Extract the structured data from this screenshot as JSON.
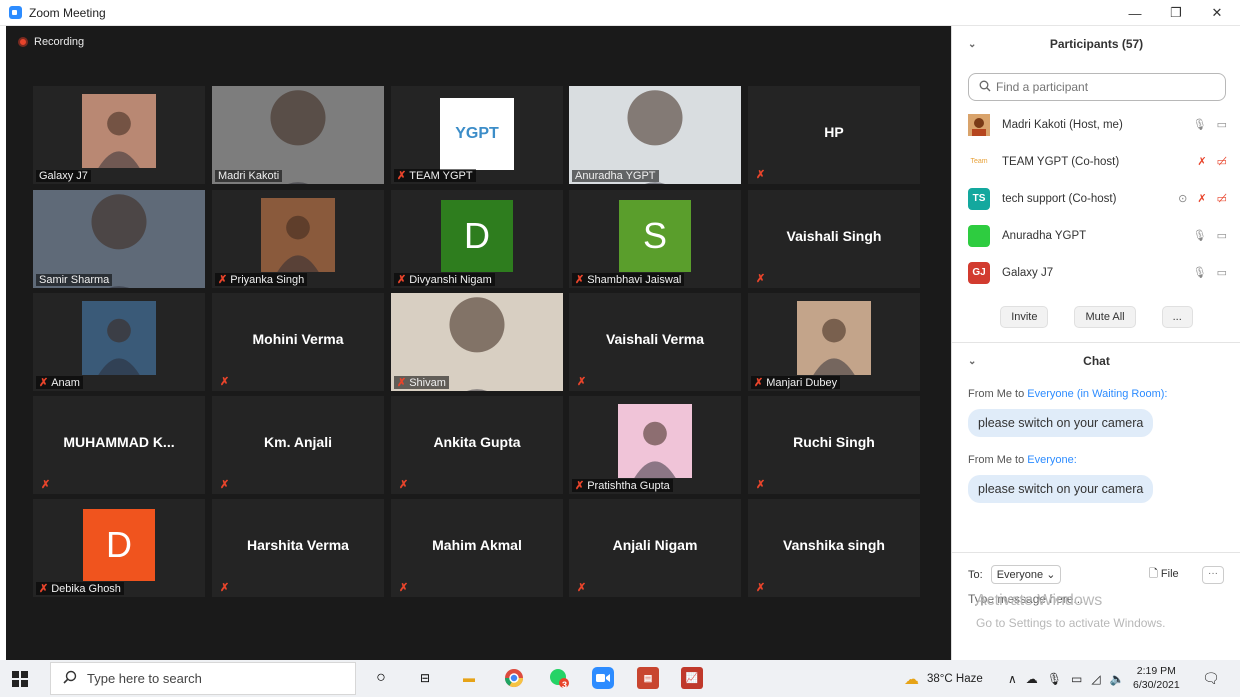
{
  "window": {
    "title": "Zoom Meeting",
    "minimize": "—",
    "maximize": "❐",
    "close": "✕"
  },
  "meeting": {
    "recording_label": "Recording",
    "tiles": [
      {
        "name": "Galaxy J7",
        "kind": "photo",
        "mic_muted": false
      },
      {
        "name": "Madri Kakoti",
        "kind": "photo-full",
        "mic_muted": false
      },
      {
        "name": "TEAM YGPT",
        "kind": "logo",
        "logo_text": "YGPT",
        "mic_muted": true
      },
      {
        "name": "Anuradha YGPT",
        "kind": "photo-full",
        "mic_muted": false,
        "active": true
      },
      {
        "name": "HP",
        "kind": "name-only",
        "mic_muted": true
      },
      {
        "name": "Samir Sharma",
        "kind": "photo-full",
        "mic_muted": false
      },
      {
        "name": "Priyanka Singh",
        "kind": "photo",
        "mic_muted": true
      },
      {
        "name": "Divyanshi Nigam",
        "kind": "letter",
        "letter": "D",
        "color": "#2e7d1e",
        "mic_muted": true
      },
      {
        "name": "Shambhavi Jaiswal",
        "kind": "letter",
        "letter": "S",
        "color": "#5a9e2c",
        "mic_muted": true
      },
      {
        "name": "Vaishali Singh",
        "kind": "name-only",
        "mic_muted": true
      },
      {
        "name": "Anam",
        "kind": "photo",
        "mic_muted": true
      },
      {
        "name": "Mohini Verma",
        "kind": "name-only",
        "mic_muted": true
      },
      {
        "name": "Shivam",
        "kind": "photo-full",
        "mic_muted": true
      },
      {
        "name": "Vaishali Verma",
        "kind": "name-only",
        "mic_muted": true
      },
      {
        "name": "Manjari Dubey",
        "kind": "photo",
        "mic_muted": true
      },
      {
        "name": "MUHAMMAD  K...",
        "kind": "name-only",
        "mic_muted": true
      },
      {
        "name": "Km. Anjali",
        "kind": "name-only",
        "mic_muted": true
      },
      {
        "name": "Ankita Gupta",
        "kind": "name-only",
        "mic_muted": true
      },
      {
        "name": "Pratishtha Gupta",
        "kind": "photo",
        "mic_muted": true
      },
      {
        "name": "Ruchi Singh",
        "kind": "name-only",
        "mic_muted": true
      },
      {
        "name": "Debika Ghosh",
        "kind": "letter",
        "letter": "D",
        "color": "#f0541e",
        "mic_muted": true
      },
      {
        "name": "Harshita Verma",
        "kind": "name-only",
        "mic_muted": true
      },
      {
        "name": "Mahim Akmal",
        "kind": "name-only",
        "mic_muted": true
      },
      {
        "name": "Anjali Nigam",
        "kind": "name-only",
        "mic_muted": true
      },
      {
        "name": "Vanshika singh",
        "kind": "name-only",
        "mic_muted": true
      }
    ]
  },
  "participants": {
    "header": "Participants (57)",
    "search_placeholder": "Find a participant",
    "list": [
      {
        "name": "Madri Kakoti (Host, me)",
        "avatar": "",
        "avatar_color": "#c8733d",
        "muted": false
      },
      {
        "name": "TEAM YGPT (Co-host)",
        "avatar": "Team",
        "avatar_color": "#ffffff",
        "muted": true
      },
      {
        "name": "tech support (Co-host)",
        "avatar": "TS",
        "avatar_color": "#13a89e",
        "muted": true
      },
      {
        "name": "Anuradha YGPT",
        "avatar": "",
        "avatar_color": "#2ecc40",
        "muted": false
      },
      {
        "name": "Galaxy J7",
        "avatar": "GJ",
        "avatar_color": "#d23b2f",
        "muted": false
      }
    ],
    "invite": "Invite",
    "mute_all": "Mute All",
    "more": "..."
  },
  "chat": {
    "header": "Chat",
    "messages": [
      {
        "from_prefix": "From Me to ",
        "to": "Everyone (in Waiting Room):",
        "text": "please switch on your camera"
      },
      {
        "from_prefix": "From Me to ",
        "to": "Everyone:",
        "text": "please switch on your camera"
      }
    ],
    "to_label": "To:",
    "to_value": "Everyone",
    "file_label": "File",
    "input_placeholder": "Type message here...",
    "watermark_title": "Activate Windows",
    "watermark_sub": "Go to Settings to activate Windows."
  },
  "taskbar": {
    "search_placeholder": "Type here to search",
    "weather": "38°C  Haze",
    "time": "2:19 PM",
    "date": "6/30/2021",
    "whatsapp_badge": "3"
  }
}
